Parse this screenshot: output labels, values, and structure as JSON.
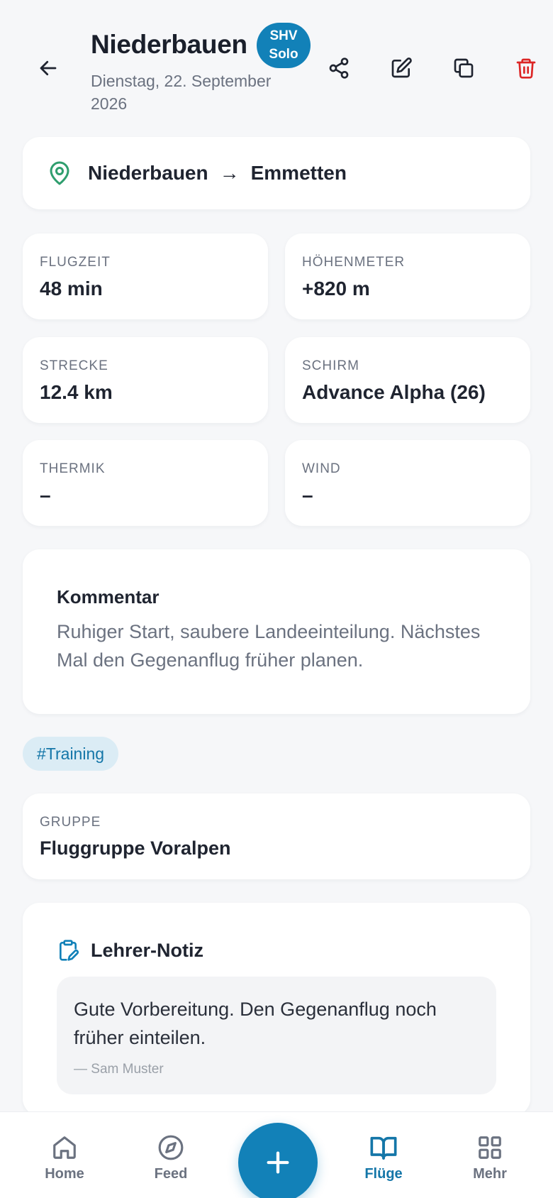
{
  "header": {
    "title": "Niederbauen",
    "badge_line1": "SHV",
    "badge_line2": "Solo",
    "date": "Dienstag, 22. September 2026"
  },
  "route": {
    "from": "Niederbauen",
    "arrow": "→",
    "to": "Emmetten"
  },
  "stats": [
    {
      "label": "FLUGZEIT",
      "value": "48 min"
    },
    {
      "label": "HÖHENMETER",
      "value": "+820 m"
    },
    {
      "label": "STRECKE",
      "value": "12.4 km"
    },
    {
      "label": "SCHIRM",
      "value": "Advance Alpha (26)"
    },
    {
      "label": "THERMIK",
      "value": "–"
    },
    {
      "label": "WIND",
      "value": "–"
    }
  ],
  "comment": {
    "heading": "Kommentar",
    "text": "Ruhiger Start, saubere Landeeinteilung. Nächstes Mal den Gegenanflug früher planen."
  },
  "tags": [
    "#Training"
  ],
  "group": {
    "label": "GRUPPE",
    "value": "Fluggruppe Voralpen"
  },
  "teacher_note": {
    "heading": "Lehrer-Notiz",
    "text": "Gute Vorbereitung. Den Gegenanflug noch früher einteilen.",
    "author": "— Sam Muster"
  },
  "tabbar": {
    "items": [
      {
        "label": "Home",
        "icon": "home-icon"
      },
      {
        "label": "Feed",
        "icon": "compass-icon"
      },
      {
        "label": "Flüge",
        "icon": "book-icon",
        "active": true
      },
      {
        "label": "Mehr",
        "icon": "grid-icon"
      }
    ],
    "fab_icon": "plus-icon"
  },
  "colors": {
    "accent": "#1281b8",
    "danger": "#dc2626",
    "pin": "#2f9e6e",
    "background": "#f6f7f9"
  }
}
